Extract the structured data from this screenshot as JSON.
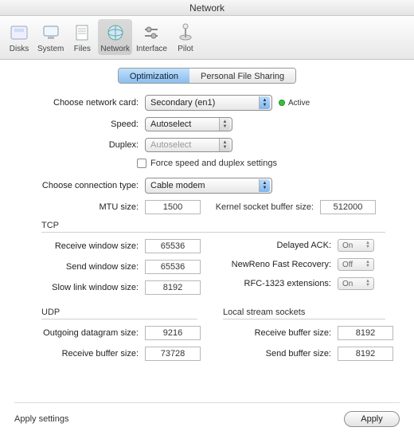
{
  "window": {
    "title": "Network"
  },
  "toolbar": {
    "items": [
      {
        "label": "Disks"
      },
      {
        "label": "System"
      },
      {
        "label": "Files"
      },
      {
        "label": "Network"
      },
      {
        "label": "Interface"
      },
      {
        "label": "Pilot"
      }
    ]
  },
  "tabs": {
    "optimization": "Optimization",
    "sharing": "Personal File Sharing"
  },
  "card": {
    "label": "Choose network card:",
    "value": "Secondary (en1)",
    "active": "Active"
  },
  "speed": {
    "label": "Speed:",
    "value": "Autoselect"
  },
  "duplex": {
    "label": "Duplex:",
    "value": "Autoselect"
  },
  "force": {
    "label": "Force speed and duplex settings"
  },
  "conn": {
    "label": "Choose connection type:",
    "value": "Cable modem"
  },
  "mtu": {
    "label": "MTU size:",
    "value": "1500"
  },
  "kbuf": {
    "label": "Kernel socket buffer size:",
    "value": "512000"
  },
  "tcp": {
    "title": "TCP",
    "recv": {
      "label": "Receive window size:",
      "value": "65536"
    },
    "send": {
      "label": "Send window size:",
      "value": "65536"
    },
    "slow": {
      "label": "Slow link window size:",
      "value": "8192"
    },
    "dack": {
      "label": "Delayed ACK:",
      "value": "On"
    },
    "newreno": {
      "label": "NewReno Fast Recovery:",
      "value": "Off"
    },
    "rfc": {
      "label": "RFC-1323 extensions:",
      "value": "On"
    }
  },
  "udp": {
    "title": "UDP",
    "out": {
      "label": "Outgoing datagram size:",
      "value": "9216"
    },
    "recv": {
      "label": "Receive buffer size:",
      "value": "73728"
    }
  },
  "lss": {
    "title": "Local stream sockets",
    "recv": {
      "label": "Receive buffer size:",
      "value": "8192"
    },
    "send": {
      "label": "Send buffer size:",
      "value": "8192"
    }
  },
  "footer": {
    "apply_settings": "Apply settings",
    "apply": "Apply"
  }
}
